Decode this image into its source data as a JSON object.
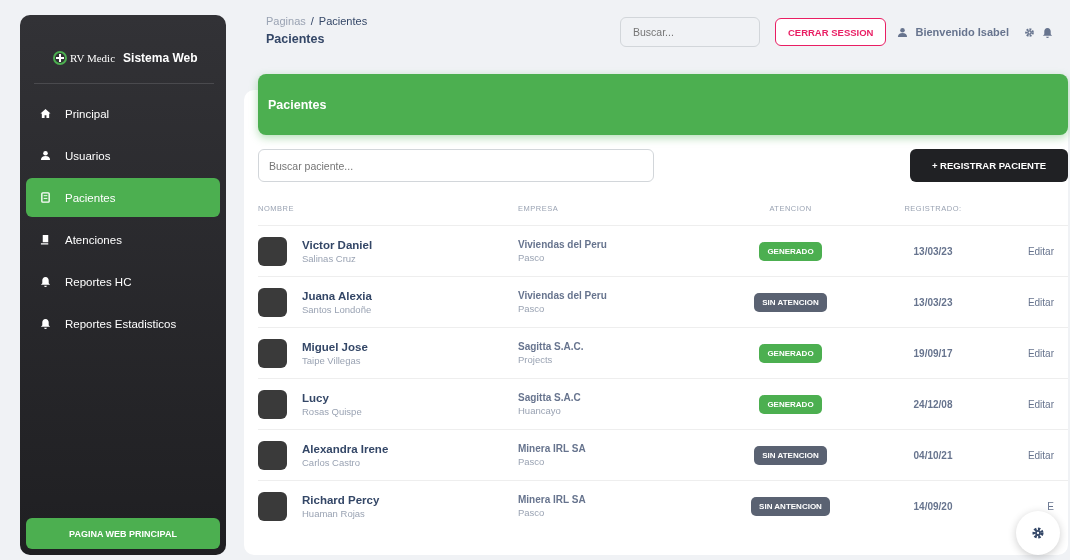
{
  "sidebar": {
    "logo_text": "RV Medic",
    "title": "Sistema Web",
    "items": [
      {
        "label": "Principal",
        "kind": "home",
        "selected": false
      },
      {
        "label": "Usuarios",
        "kind": "user",
        "selected": false
      },
      {
        "label": "Pacientes",
        "kind": "book",
        "selected": true
      },
      {
        "label": "Atenciones",
        "kind": "doc",
        "selected": false
      },
      {
        "label": "Reportes HC",
        "kind": "bell",
        "selected": false
      },
      {
        "label": "Reportes Estadisticos",
        "kind": "bell",
        "selected": false
      }
    ],
    "bottom_button": "PAGINA WEB PRINCIPAL"
  },
  "header": {
    "breadcrumb": [
      "Paginas",
      "/",
      "Pacientes"
    ],
    "page_title": "Pacientes",
    "search": {
      "placeholder": "Buscar..."
    },
    "logout": "CERRAR SESSION",
    "welcome": "Bienvenido Isabel"
  },
  "card": {
    "title": "Pacientes",
    "search": {
      "placeholder": "Buscar paciente..."
    },
    "register_button": "+  REGISTRAR PACIENTE",
    "table": {
      "columns": [
        "NOMBRE",
        "EMPRESA",
        "ATENCION",
        "REGISTRADO:"
      ],
      "rows": [
        {
          "name": "Victor Daniel",
          "surname": "Salinas Cruz",
          "company": "Viviendas del Peru",
          "location": "Pasco",
          "status": {
            "kind": "done",
            "label": "GENERADO"
          },
          "date": "13/03/23",
          "action": "Editar"
        },
        {
          "name": "Juana Alexia",
          "surname": "Santos Londoñe",
          "company": "Viviendas del Peru",
          "location": "Pasco",
          "status": {
            "kind": "pending",
            "label": "SIN ATENCION"
          },
          "date": "13/03/23",
          "action": "Editar"
        },
        {
          "name": "Miguel Jose",
          "surname": "Taipe Villegas",
          "company": "Sagitta S.A.C.",
          "location": "Projects",
          "status": {
            "kind": "done",
            "label": "GENERADO"
          },
          "date": "19/09/17",
          "action": "Editar"
        },
        {
          "name": "Lucy",
          "surname": "Rosas Quispe",
          "company": "Sagitta S.A.C",
          "location": "Huancayo",
          "status": {
            "kind": "done",
            "label": "GENERADO"
          },
          "date": "24/12/08",
          "action": "Editar"
        },
        {
          "name": "Alexandra Irene",
          "surname": "Carlos Castro",
          "company": "Minera IRL SA",
          "location": "Pasco",
          "status": {
            "kind": "pending",
            "label": "SIN ATENCION"
          },
          "date": "04/10/21",
          "action": "Editar"
        },
        {
          "name": "Richard Percy",
          "surname": "Huaman Rojas",
          "company": "Minera IRL SA",
          "location": "Pasco",
          "status": {
            "kind": "pending",
            "label": "SIN ANTENCION"
          },
          "date": "14/09/20",
          "action": "E"
        }
      ]
    }
  }
}
